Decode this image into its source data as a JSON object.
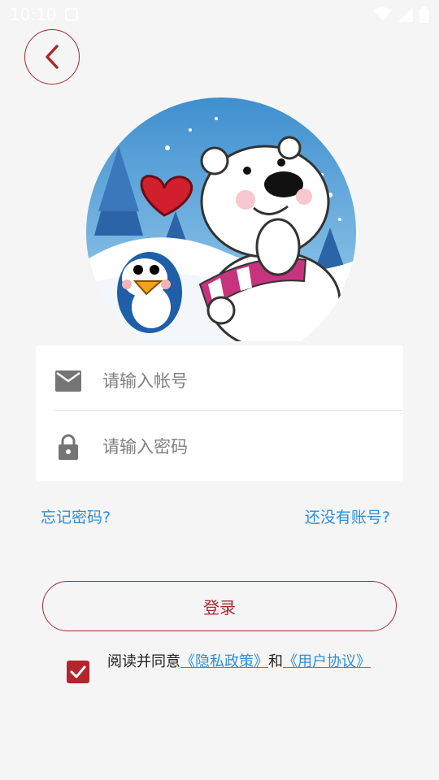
{
  "status_bar": {
    "time": "10:10",
    "icons": [
      "app-notification-icon",
      "wifi-icon",
      "signal-icon",
      "battery-icon"
    ]
  },
  "header": {
    "back_icon": "chevron-left-icon"
  },
  "avatar": {
    "description_icon": "polar-bear-penguin-illustration"
  },
  "form": {
    "account_icon": "mail-icon",
    "account_placeholder": "请输入帐号",
    "account_value": "",
    "password_icon": "lock-icon",
    "password_placeholder": "请输入密码",
    "password_value": ""
  },
  "links": {
    "forgot": "忘记密码?",
    "register": "还没有账号?"
  },
  "login_button": "登录",
  "agreement": {
    "checked": true,
    "prefix": "阅读并同意",
    "privacy": "《隐私政策》",
    "and": "和",
    "user_agreement": "《用户协议》"
  },
  "colors": {
    "accent": "#a8292f",
    "checkbox": "#b3262d",
    "link": "#2d8fd8",
    "background": "#f5f5f5"
  }
}
